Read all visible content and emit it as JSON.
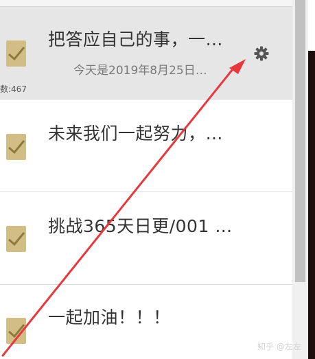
{
  "items": [
    {
      "title": "把答应自己的事，一…",
      "subtitle": "今天是2019年8月25日…",
      "count": "数:467",
      "selected": true
    },
    {
      "title": "未来我们一起努力，…"
    },
    {
      "title": "挑战365天日更/001 …"
    },
    {
      "title": "一起加油！！！"
    }
  ],
  "watermark": "知乎 @左左",
  "colors": {
    "checkbox": "#d2be84",
    "checkmark": "#8b7b3c",
    "selected_row": "#e6e6e6",
    "arrow": "#e8383d",
    "scroll_thumb": "#c1c1c1"
  },
  "icons": {
    "settings": "gear-icon",
    "checkbox": "checkbox-checked-icon",
    "annotation": "red-arrow"
  }
}
